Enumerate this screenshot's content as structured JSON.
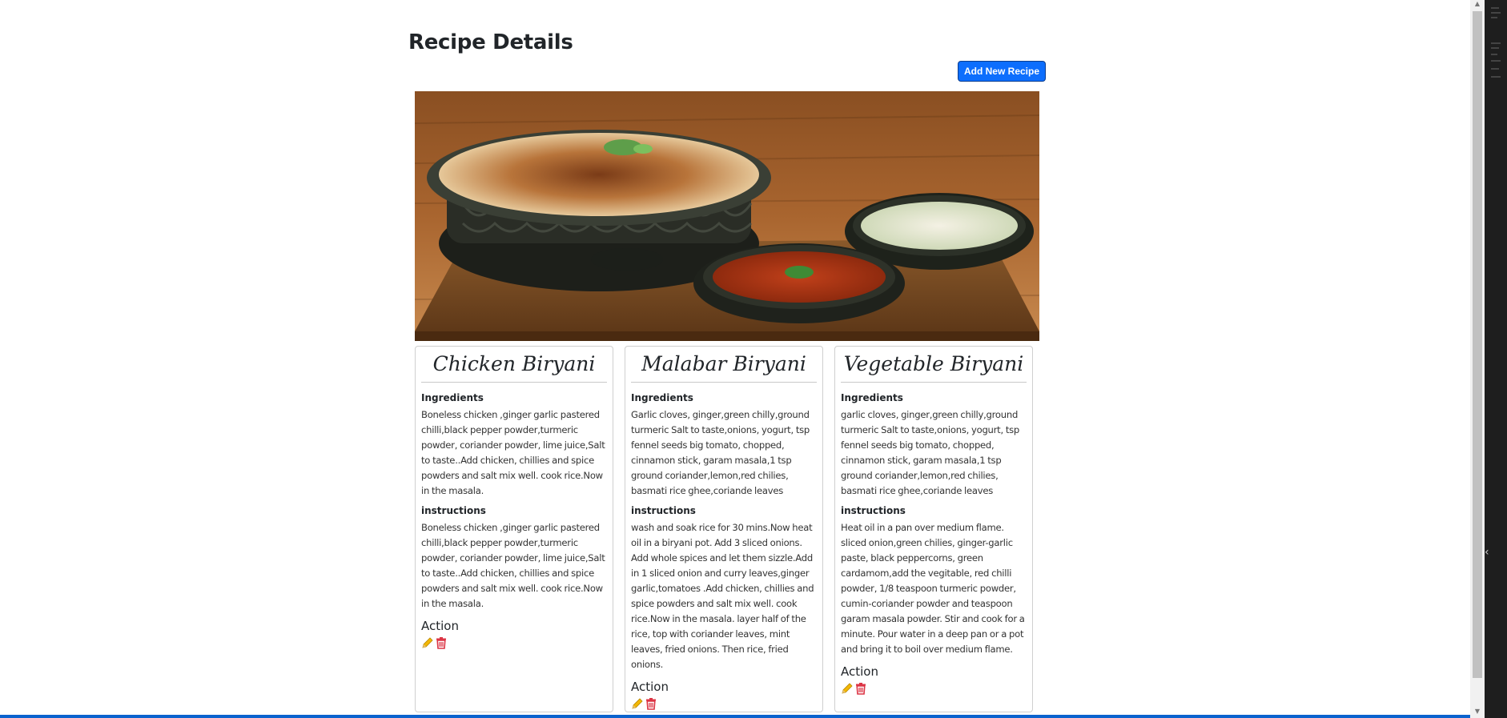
{
  "page": {
    "title": "Recipe Details",
    "add_button_label": "Add New Recipe"
  },
  "hero_image": {
    "alt": "Biryani dish with side bowls"
  },
  "recipes": [
    {
      "name": "Chicken Biryani",
      "ingredients_label": "Ingredients",
      "ingredients": "Boneless chicken ,ginger garlic pastered chilli,black pepper powder,turmeric powder, coriander powder, lime juice,Salt to taste..Add chicken, chillies and spice powders and salt mix well. cook rice.Now in the masala.",
      "instructions_label": "instructions",
      "instructions": "Boneless chicken ,ginger garlic pastered chilli,black pepper powder,turmeric powder, coriander powder, lime juice,Salt to taste..Add chicken, chillies and spice powders and salt mix well. cook rice.Now in the masala.",
      "action_label": "Action"
    },
    {
      "name": "Malabar Biryani",
      "ingredients_label": "Ingredients",
      "ingredients": "Garlic cloves, ginger,green chilly,ground turmeric Salt to taste,onions, yogurt, tsp fennel seeds big tomato, chopped, cinnamon stick, garam masala,1 tsp ground coriander,lemon,red chilies, basmati rice ghee,coriande leaves",
      "instructions_label": "instructions",
      "instructions": "wash and soak rice for 30 mins.Now heat oil in a biryani pot. Add 3 sliced onions. Add whole spices and let them sizzle.Add in 1 sliced onion and curry leaves,ginger garlic,tomatoes .Add chicken, chillies and spice powders and salt mix well. cook rice.Now in the masala. layer half of the rice, top with coriander leaves, mint leaves, fried onions. Then rice, fried onions.",
      "action_label": "Action"
    },
    {
      "name": "Vegetable Biryani",
      "ingredients_label": "Ingredients",
      "ingredients": "garlic cloves, ginger,green chilly,ground turmeric Salt to taste,onions, yogurt, tsp fennel seeds big tomato, chopped, cinnamon stick, garam masala,1 tsp ground coriander,lemon,red chilies, basmati rice ghee,coriande leaves",
      "instructions_label": "instructions",
      "instructions": "Heat oil in a pan over medium flame. sliced onion,green chilies, ginger-garlic paste, black peppercorns, green cardamom,add the vegitable, red chilli powder, 1/8 teaspoon turmeric powder, cumin-coriander powder and teaspoon garam masala powder. Stir and cook for a minute. Pour water in a deep pan or a pot and bring it to boil over medium flame.",
      "action_label": "Action"
    }
  ],
  "icons": {
    "edit": "pencil-icon",
    "delete": "trash-icon"
  },
  "colors": {
    "primary": "#0d6efd",
    "edit_icon": "#f2b705",
    "delete_icon": "#dc3545"
  }
}
